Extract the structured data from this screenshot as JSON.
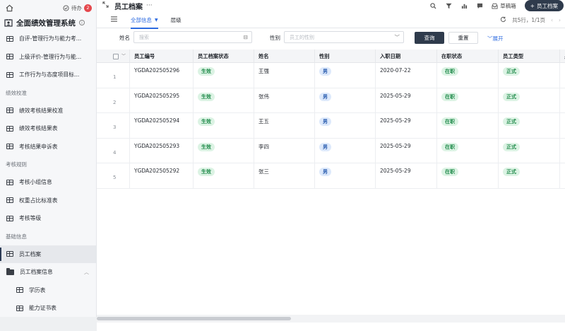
{
  "sidebar": {
    "todo_label": "待办",
    "todo_count": "2",
    "app_title": "全面绩效管理系统",
    "info_glyph": "i",
    "items_top": [
      {
        "label": "自评-管理行为与能力考..."
      },
      {
        "label": "上级评价-管理行为与能..."
      },
      {
        "label": "工作行为与态度项目标..."
      }
    ],
    "section_calibration": "绩效校准",
    "items_calibration": [
      {
        "label": "绩效考核结果校准"
      },
      {
        "label": "绩效考核结果表"
      },
      {
        "label": "考核结果申诉表"
      }
    ],
    "section_rules": "考核规则",
    "items_rules": [
      {
        "label": "考核小组信息"
      },
      {
        "label": "权重占比标准表"
      },
      {
        "label": "考核等级"
      }
    ],
    "section_base": "基础信息",
    "item_active": "员工档案",
    "item_folder": "员工档案信息",
    "items_sub": [
      {
        "label": "学历表"
      },
      {
        "label": "能力证书表"
      }
    ]
  },
  "header": {
    "title": "员工档案",
    "more_glyph": "···",
    "draft_label": "草稿箱",
    "add_label": "员工档案",
    "add_glyph": "+"
  },
  "tabs": {
    "tab_all": "全部信息",
    "tab_level": "层级",
    "record_info": "共5行，1/1页"
  },
  "filter": {
    "name_label": "姓名",
    "name_placeholder": "搜索",
    "gender_label": "性别",
    "gender_placeholder": "员工的性别",
    "query_btn": "查询",
    "reset_btn": "重置",
    "expand_btn": "展开"
  },
  "table": {
    "columns": [
      "员工编号",
      "员工档案状态",
      "姓名",
      "性别",
      "入职日期",
      "在职状态",
      "员工类型",
      "身"
    ],
    "rows": [
      {
        "num": "1",
        "id": "YGDA202505296",
        "status": "生效",
        "name": "王强",
        "gender": "男",
        "date": "2020-07-22",
        "job_status": "在职",
        "type": "正式"
      },
      {
        "num": "2",
        "id": "YGDA202505295",
        "status": "生效",
        "name": "张伟",
        "gender": "男",
        "date": "2025-05-29",
        "job_status": "在职",
        "type": "正式"
      },
      {
        "num": "3",
        "id": "YGDA202505294",
        "status": "生效",
        "name": "王五",
        "gender": "男",
        "date": "2025-05-29",
        "job_status": "在职",
        "type": "正式"
      },
      {
        "num": "4",
        "id": "YGDA202505293",
        "status": "生效",
        "name": "李四",
        "gender": "男",
        "date": "2025-05-29",
        "job_status": "在职",
        "type": "正式"
      },
      {
        "num": "5",
        "id": "YGDA202505292",
        "status": "生效",
        "name": "张三",
        "gender": "男",
        "date": "2025-05-29",
        "job_status": "在职",
        "type": "正式"
      }
    ]
  },
  "colors": {
    "accent": "#2d6be0",
    "primary_dark": "#2f3b4c",
    "tag_green_bg": "#dcf3e4",
    "tag_blue_bg": "#dde9fb",
    "badge_red": "#e5484d"
  }
}
